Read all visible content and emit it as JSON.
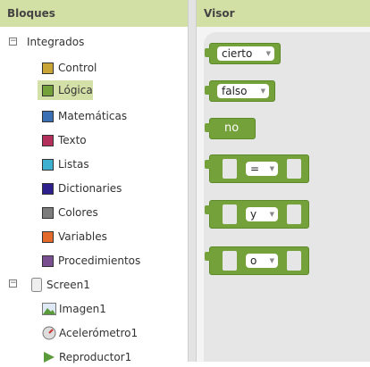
{
  "left": {
    "header": "Bloques",
    "integrados": "Integrados",
    "categories": [
      {
        "label": "Control",
        "color": "#c9a538"
      },
      {
        "label": "Lógica",
        "color": "#74a13a",
        "selected": true
      },
      {
        "label": "Matemáticas",
        "color": "#3b6fb3"
      },
      {
        "label": "Texto",
        "color": "#b3305c"
      },
      {
        "label": "Listas",
        "color": "#3fb1d0"
      },
      {
        "label": "Dictionaries",
        "color": "#2d1f8c"
      },
      {
        "label": "Colores",
        "color": "#7c7c7c"
      },
      {
        "label": "Variables",
        "color": "#e36a2a"
      },
      {
        "label": "Procedimientos",
        "color": "#7a4f8f"
      }
    ],
    "screen": "Screen1",
    "components": [
      {
        "label": "Imagen1",
        "icon": "image-icon"
      },
      {
        "label": "Acelerómetro1",
        "icon": "accelerometer-icon"
      },
      {
        "label": "Reproductor1",
        "icon": "player-icon"
      }
    ]
  },
  "right": {
    "header": "Visor",
    "blocks": {
      "b1": "cierto",
      "b2": "falso",
      "b3": "no",
      "b4": "=",
      "b5": "y",
      "b6": "o"
    }
  }
}
